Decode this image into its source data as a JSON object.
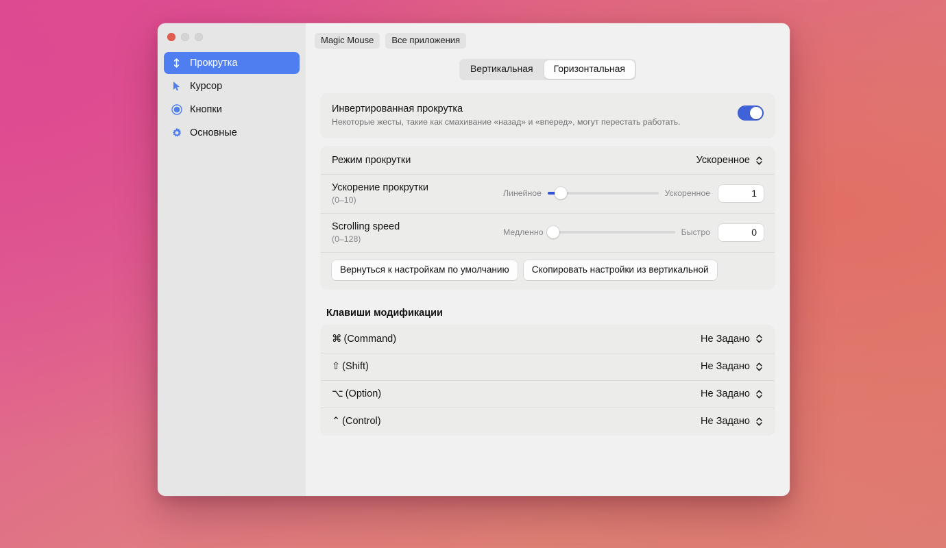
{
  "window": {
    "traffic_lights": [
      "close",
      "minimize",
      "maximize"
    ]
  },
  "sidebar": {
    "items": [
      {
        "label": "Прокрутка",
        "icon": "scroll-updown-icon",
        "selected": true
      },
      {
        "label": "Курсор",
        "icon": "cursor-arrow-icon",
        "selected": false
      },
      {
        "label": "Кнопки",
        "icon": "radio-circle-icon",
        "selected": false
      },
      {
        "label": "Основные",
        "icon": "gear-icon",
        "selected": false
      }
    ]
  },
  "top_tabs": [
    {
      "label": "Magic Mouse"
    },
    {
      "label": "Все приложения"
    }
  ],
  "segmented": {
    "options": [
      {
        "label": "Вертикальная",
        "active": false
      },
      {
        "label": "Горизонтальная",
        "active": true
      }
    ]
  },
  "invert": {
    "title": "Инвертированная прокрутка",
    "subtitle": "Некоторые жесты, такие как смахивание «назад» и «вперед», могут перестать работать.",
    "toggle_on": true,
    "toggle_color": "#3f62d8"
  },
  "scroll_mode": {
    "label": "Режим прокрутки",
    "value": "Ускоренное"
  },
  "acceleration": {
    "label": "Ускорение прокрутки",
    "range": "(0–10)",
    "min_label": "Линейное",
    "max_label": "Ускоренное",
    "value": "1",
    "thumb_percent": 12,
    "fill_color": "#3253d6"
  },
  "speed": {
    "label": "Scrolling speed",
    "range": "(0–128)",
    "min_label": "Медленно",
    "max_label": "Быстро",
    "value": "0",
    "thumb_percent": 3
  },
  "buttons": {
    "reset": "Вернуться к настройкам по умолчанию",
    "copy": "Скопировать настройки из вертикальной"
  },
  "modifiers": {
    "title": "Клавиши модификации",
    "rows": [
      {
        "glyph": "⌘",
        "name": "(Command)",
        "value": "Не Задано"
      },
      {
        "glyph": "⇧",
        "name": "(Shift)",
        "value": "Не Задано"
      },
      {
        "glyph": "⌥",
        "name": "(Option)",
        "value": "Не Задано"
      },
      {
        "glyph": "⌃",
        "name": "(Control)",
        "value": "Не Задано"
      }
    ]
  }
}
